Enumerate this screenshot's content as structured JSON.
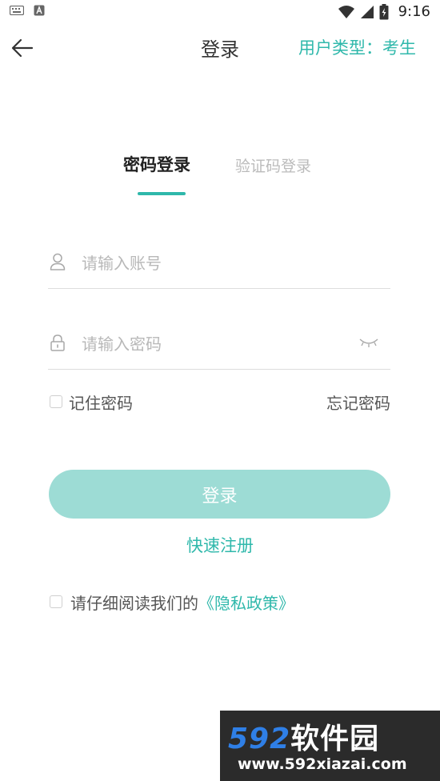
{
  "status_bar": {
    "time": "9:16",
    "icons": [
      "keyboard-icon",
      "a-notification-icon",
      "wifi-icon",
      "signal-icon",
      "battery-icon"
    ]
  },
  "header": {
    "title": "登录",
    "user_type": "用户类型：考生",
    "back_icon": "arrow-left-icon"
  },
  "tabs": [
    {
      "label": "密码登录",
      "active": true
    },
    {
      "label": "验证码登录",
      "active": false
    }
  ],
  "form": {
    "username_placeholder": "请输入账号",
    "password_placeholder": "请输入密码",
    "username_icon": "user-icon",
    "password_icon": "lock-icon",
    "toggle_icon": "eye-closed-icon"
  },
  "options": {
    "remember_label": "记住密码",
    "forgot_label": "忘记密码"
  },
  "actions": {
    "login_label": "登录",
    "register_label": "快速注册"
  },
  "privacy": {
    "text": "请仔细阅读我们的",
    "link": "《隐私政策》"
  },
  "watermark": {
    "logo_number": "592",
    "logo_text": "软件园",
    "url": "www.592xiazai.com"
  },
  "colors": {
    "accent": "#2fb8ab",
    "button_bg": "#9ddcd5",
    "placeholder": "#b8b8b8",
    "divider": "#dddddd"
  }
}
